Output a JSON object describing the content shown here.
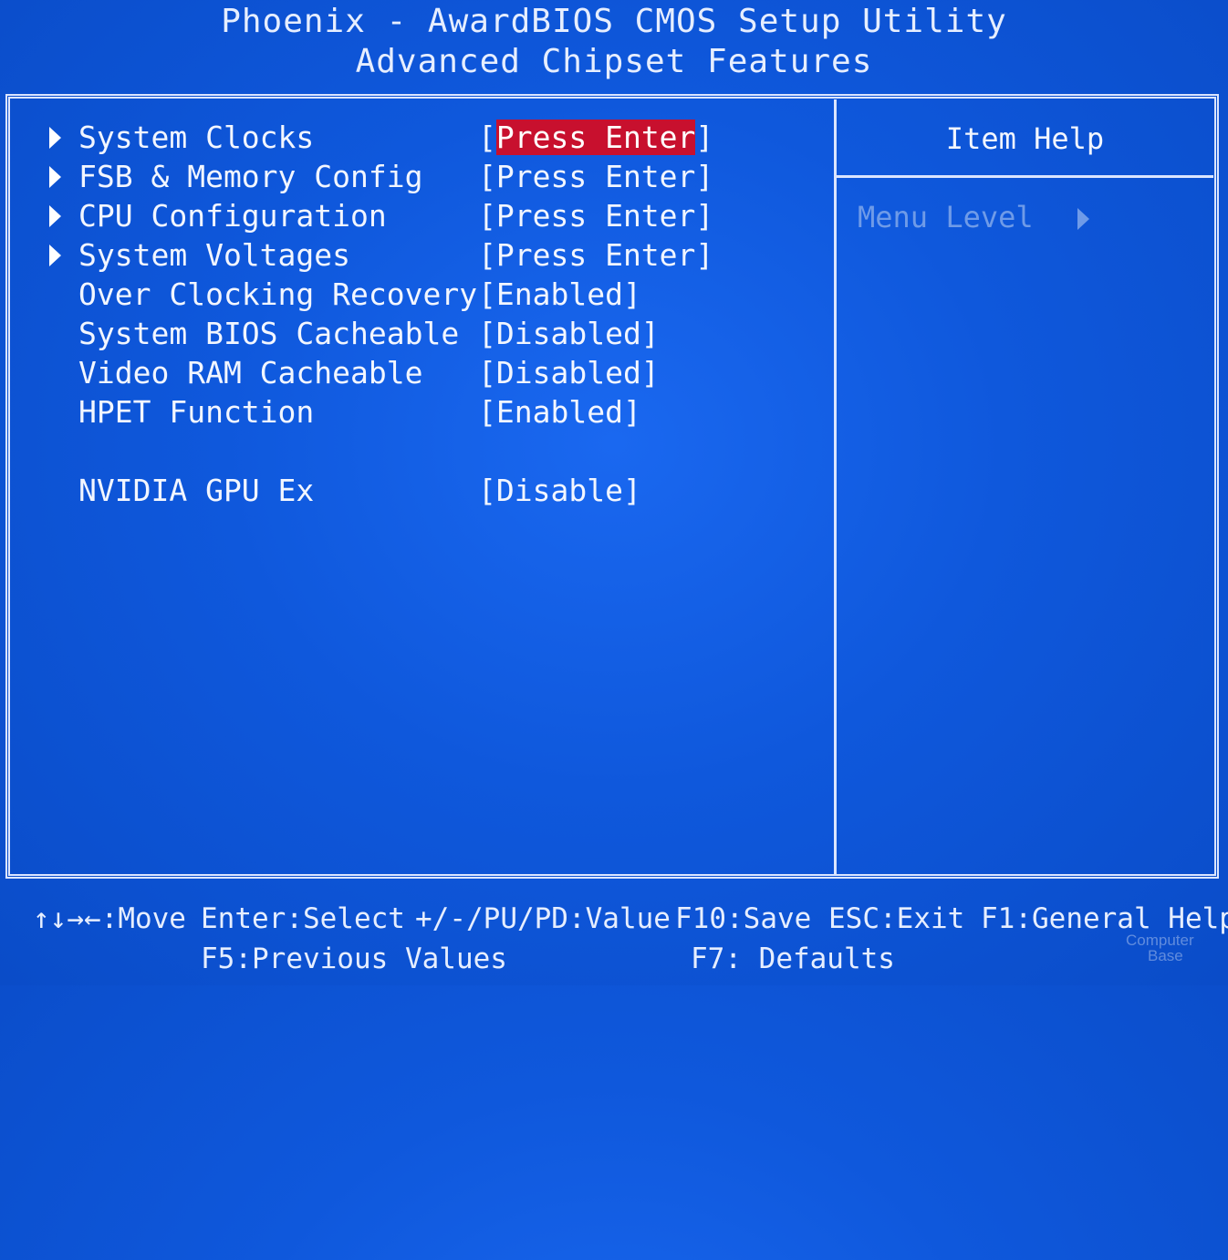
{
  "header": {
    "title": "Phoenix - AwardBIOS CMOS Setup Utility",
    "subtitle": "Advanced Chipset Features"
  },
  "menu": [
    {
      "label": "System Clocks",
      "value_open": "[",
      "value": "Press Enter",
      "value_close": "]",
      "submenu": true,
      "selected": true
    },
    {
      "label": "FSB & Memory Config",
      "value": "[Press Enter]",
      "submenu": true
    },
    {
      "label": "CPU Configuration",
      "value": "[Press Enter]",
      "submenu": true
    },
    {
      "label": "System Voltages",
      "value": "[Press Enter]",
      "submenu": true
    },
    {
      "label": "Over Clocking Recovery",
      "value": "[Enabled]",
      "submenu": false
    },
    {
      "label": "System BIOS Cacheable",
      "value": "[Disabled]",
      "submenu": false
    },
    {
      "label": "Video RAM Cacheable",
      "value": "[Disabled]",
      "submenu": false
    },
    {
      "label": "HPET Function",
      "value": "[Enabled]",
      "submenu": false
    },
    {
      "label": "NVIDIA GPU Ex",
      "value": "[Disable]",
      "submenu": false
    }
  ],
  "help": {
    "title": "Item Help",
    "menu_level": "Menu Level",
    "menu_level_icon": "triangle-right-icon"
  },
  "footer": {
    "move": "↑↓→←:Move",
    "select": "Enter:Select",
    "value": "+/-/PU/PD:Value",
    "save": "F10:Save",
    "exit": "ESC:Exit",
    "general_help": "F1:General Help",
    "previous": "F5:Previous Values",
    "defaults": "F7: Defaults"
  },
  "watermark": {
    "line1": "Computer",
    "line2": "Base"
  },
  "colors": {
    "background": "#0b52d6",
    "highlight": "#c8102e",
    "frame": "#dbe5ff",
    "dim_text": "#6f9be8"
  }
}
